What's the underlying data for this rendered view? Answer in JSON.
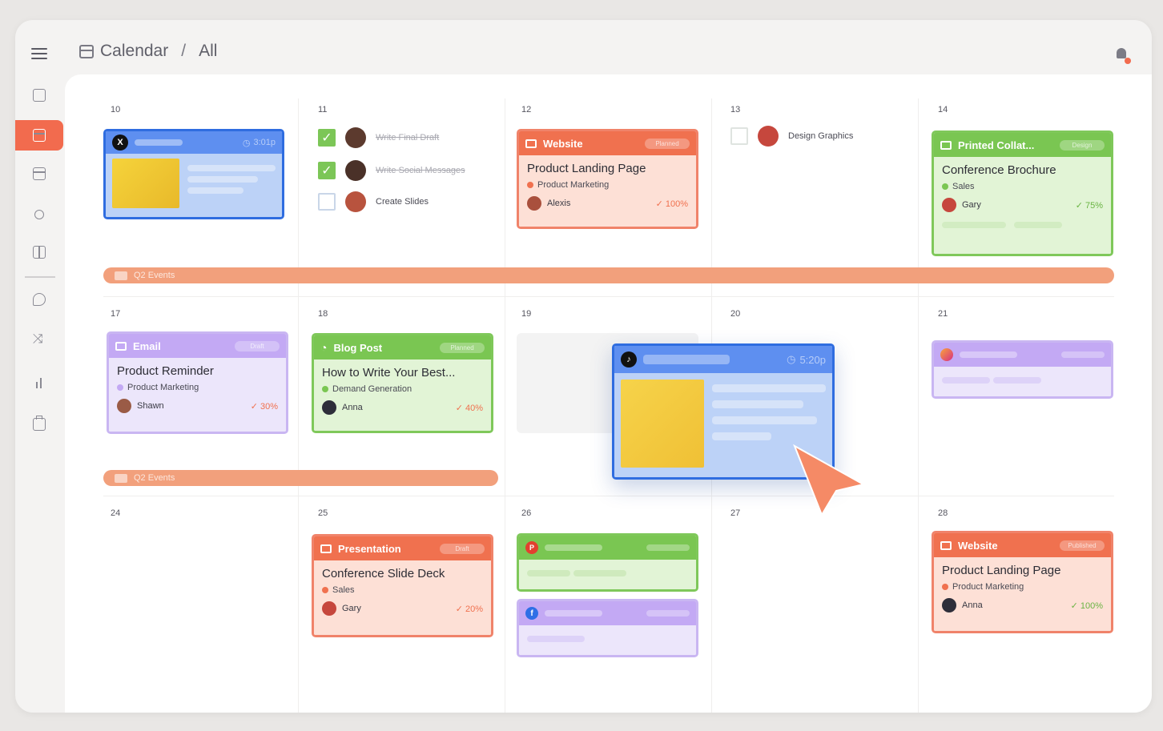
{
  "header": {
    "breadcrumb_root": "Calendar",
    "breadcrumb_sep": "/",
    "breadcrumb_leaf": "All"
  },
  "sidebar": {
    "items": [
      {
        "icon": "home-icon"
      },
      {
        "icon": "calendar-icon",
        "active": true
      },
      {
        "icon": "layout-icon"
      },
      {
        "icon": "people-icon"
      },
      {
        "icon": "book-icon"
      },
      {
        "icon": "chat-icon"
      },
      {
        "icon": "shuffle-icon"
      },
      {
        "icon": "chart-icon"
      },
      {
        "icon": "briefcase-icon"
      }
    ]
  },
  "days": {
    "d10": "10",
    "d11": "11",
    "d12": "12",
    "d13": "13",
    "d14": "14",
    "d17": "17",
    "d18": "18",
    "d19": "19",
    "d20": "20",
    "d21": "21",
    "d24": "24",
    "d25": "25",
    "d26": "26",
    "d27": "27",
    "d28": "28"
  },
  "tasks": {
    "t1": "Write Final Draft",
    "t2": "Write Social Messages",
    "t3": "Create Slides",
    "t4": "Design Graphics"
  },
  "events": {
    "bar1": "Q2 Events",
    "bar2": "Q2 Events"
  },
  "twitter_card": {
    "time": "3:01p"
  },
  "tiktok_card": {
    "time": "5:20p"
  },
  "cards": {
    "website1": {
      "type": "Website",
      "status": "Planned",
      "title": "Product Landing Page",
      "tag": "Product Marketing",
      "person": "Alexis",
      "pct": "✓ 100%"
    },
    "printed": {
      "type": "Printed Collat...",
      "status": "Design",
      "title": "Conference Brochure",
      "tag": "Sales",
      "person": "Gary",
      "pct": "✓ 75%"
    },
    "email": {
      "type": "Email",
      "status": "Draft",
      "title": "Product Reminder",
      "tag": "Product Marketing",
      "person": "Shawn",
      "pct": "✓ 30%"
    },
    "blog": {
      "type": "Blog Post",
      "status": "Planned",
      "title": "How to Write Your Best...",
      "tag": "Demand Generation",
      "person": "Anna",
      "pct": "✓ 40%"
    },
    "presentation": {
      "type": "Presentation",
      "status": "Draft",
      "title": "Conference Slide Deck",
      "tag": "Sales",
      "person": "Gary",
      "pct": "✓ 20%"
    },
    "website2": {
      "type": "Website",
      "status": "Published",
      "title": "Product Landing Page",
      "tag": "Product Marketing",
      "person": "Anna",
      "pct": "✓ 100%"
    }
  },
  "colors": {
    "accent": "#f26b4e",
    "orange": "#f0714f",
    "green": "#7ac652",
    "purple": "#c3a9f4",
    "blue": "#5e8ff0"
  }
}
